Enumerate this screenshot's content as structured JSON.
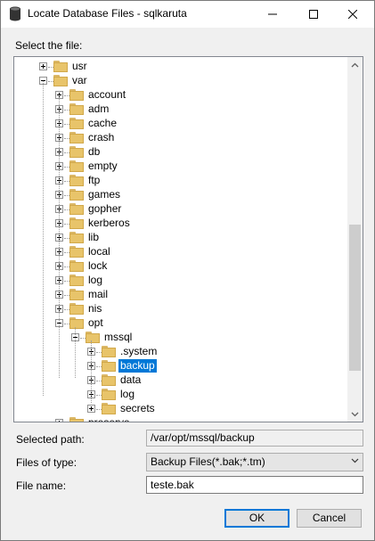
{
  "window": {
    "title": "Locate Database Files - sqlkaruta",
    "app_icon": "database-icon",
    "minimize_icon": "minimize-icon",
    "maximize_icon": "maximize-icon",
    "close_icon": "close-icon"
  },
  "tree": {
    "label": "Select the file:",
    "nodes": [
      {
        "label": "usr",
        "expanded": false
      },
      {
        "label": "var",
        "expanded": true
      },
      {
        "label": "account",
        "expanded": false
      },
      {
        "label": "adm",
        "expanded": false
      },
      {
        "label": "cache",
        "expanded": false
      },
      {
        "label": "crash",
        "expanded": false
      },
      {
        "label": "db",
        "expanded": false
      },
      {
        "label": "empty",
        "expanded": false
      },
      {
        "label": "ftp",
        "expanded": false
      },
      {
        "label": "games",
        "expanded": false
      },
      {
        "label": "gopher",
        "expanded": false
      },
      {
        "label": "kerberos",
        "expanded": false
      },
      {
        "label": "lib",
        "expanded": false
      },
      {
        "label": "local",
        "expanded": false
      },
      {
        "label": "lock",
        "expanded": false
      },
      {
        "label": "log",
        "expanded": false
      },
      {
        "label": "mail",
        "expanded": false
      },
      {
        "label": "nis",
        "expanded": false
      },
      {
        "label": "opt",
        "expanded": true
      },
      {
        "label": "mssql",
        "expanded": true
      },
      {
        "label": ".system",
        "expanded": false
      },
      {
        "label": "backup",
        "expanded": false,
        "selected": true
      },
      {
        "label": "data",
        "expanded": false
      },
      {
        "label": "log",
        "expanded": false
      },
      {
        "label": "secrets",
        "expanded": false
      },
      {
        "label": "preserve",
        "expanded": false
      }
    ],
    "selection_color": "#0078d7"
  },
  "form": {
    "selected_path_label": "Selected path:",
    "selected_path_value": "/var/opt/mssql/backup",
    "files_of_type_label": "Files of type:",
    "files_of_type_value": "Backup Files(*.bak;*.tm)",
    "file_name_label": "File name:",
    "file_name_value": "teste.bak"
  },
  "buttons": {
    "ok": "OK",
    "cancel": "Cancel"
  }
}
